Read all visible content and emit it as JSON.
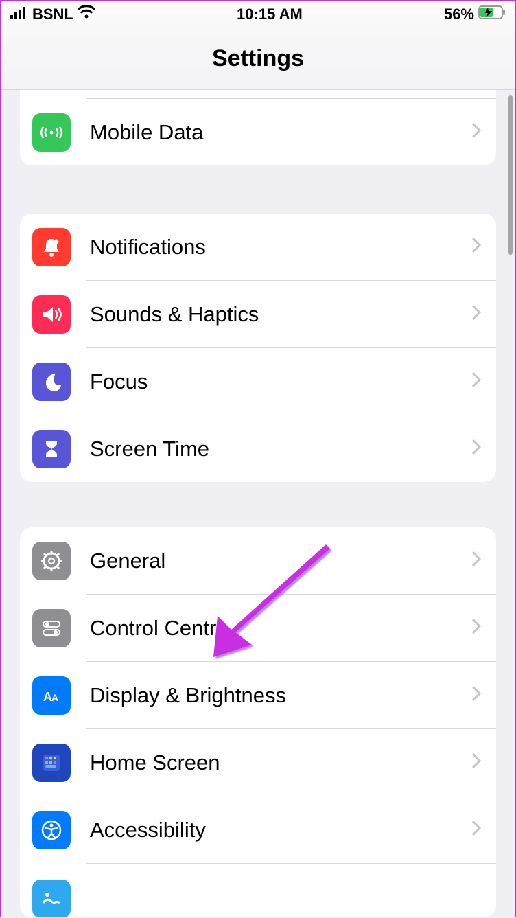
{
  "status": {
    "carrier": "BSNL",
    "time": "10:15 AM",
    "battery_pct": "56%"
  },
  "nav": {
    "title": "Settings"
  },
  "group0": {
    "items": [
      {
        "label": ""
      },
      {
        "label": "Mobile Data"
      }
    ]
  },
  "group1": {
    "items": [
      {
        "label": "Notifications"
      },
      {
        "label": "Sounds & Haptics"
      },
      {
        "label": "Focus"
      },
      {
        "label": "Screen Time"
      }
    ]
  },
  "group2": {
    "items": [
      {
        "label": "General"
      },
      {
        "label": "Control Centre"
      },
      {
        "label": "Display & Brightness"
      },
      {
        "label": "Home Screen"
      },
      {
        "label": "Accessibility"
      },
      {
        "label": ""
      }
    ]
  }
}
